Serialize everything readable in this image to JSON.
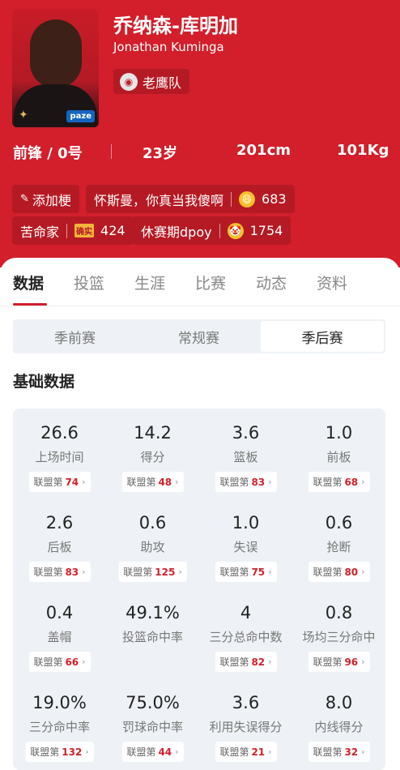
{
  "player": {
    "name_cn": "乔纳森-库明加",
    "name_en": "Jonathan Kuminga",
    "team": "老鹰队",
    "photo_badge": "paze",
    "position_number": "前锋 / 0号",
    "age": "23岁",
    "height": "201cm",
    "weight": "101Kg"
  },
  "tags": {
    "add_label": "添加梗",
    "tag1_text": "怀斯曼，你真当我傻啊",
    "tag1_count": "683",
    "tag2_text": "苦命家",
    "tag2_badge": "确实",
    "tag2_count": "424",
    "tag3_text": "休赛期dpoy",
    "tag3_count": "1754"
  },
  "tabs": [
    "数据",
    "投篮",
    "生涯",
    "比赛",
    "动态",
    "资料"
  ],
  "segments": [
    "季前赛",
    "常规赛",
    "季后赛"
  ],
  "section_title": "基础数据",
  "rank_prefix": "联盟第",
  "stats": [
    {
      "value": "26.6",
      "label": "上场时间",
      "rank": "74"
    },
    {
      "value": "14.2",
      "label": "得分",
      "rank": "48"
    },
    {
      "value": "3.6",
      "label": "篮板",
      "rank": "83"
    },
    {
      "value": "1.0",
      "label": "前板",
      "rank": "68"
    },
    {
      "value": "2.6",
      "label": "后板",
      "rank": "83"
    },
    {
      "value": "0.6",
      "label": "助攻",
      "rank": "125"
    },
    {
      "value": "1.0",
      "label": "失误",
      "rank": "75"
    },
    {
      "value": "0.6",
      "label": "抢断",
      "rank": "80"
    },
    {
      "value": "0.4",
      "label": "盖帽",
      "rank": "66"
    },
    {
      "value": "49.1%",
      "label": "投篮命中率",
      "rank": ""
    },
    {
      "value": "4",
      "label": "三分总命中数",
      "rank": "82"
    },
    {
      "value": "0.8",
      "label": "场均三分命中",
      "rank": "96"
    },
    {
      "value": "19.0%",
      "label": "三分命中率",
      "rank": "132"
    },
    {
      "value": "75.0%",
      "label": "罚球命中率",
      "rank": "44"
    },
    {
      "value": "3.6",
      "label": "利用失误得分",
      "rank": "21"
    },
    {
      "value": "8.0",
      "label": "内线得分",
      "rank": "32"
    }
  ],
  "colors": {
    "brand_red": "#d21f2b",
    "panel": "#eef2f6"
  }
}
